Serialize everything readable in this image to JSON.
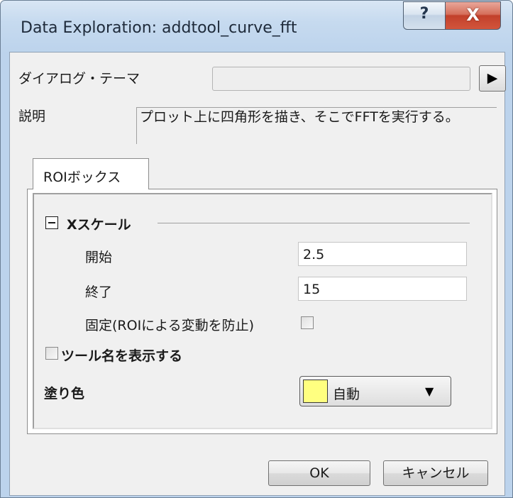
{
  "window": {
    "title": "Data Exploration: addtool_curve_fft",
    "help_glyph": "?",
    "close_glyph": "X"
  },
  "theme": {
    "label": "ダイアログ・テーマ",
    "value": "",
    "arrow_glyph": "▶"
  },
  "description": {
    "label": "説明",
    "text": "プロット上に四角形を描き、そこでFFTを実行する。"
  },
  "tab": {
    "label": "ROIボックス"
  },
  "xscale": {
    "header": "Xスケール",
    "start_label": "開始",
    "start_value": "2.5",
    "end_label": "終了",
    "end_value": "15",
    "fix_label": "固定(ROIによる変動を防止)",
    "fix_checked": false
  },
  "show_tool_name": {
    "label": "ツール名を表示する",
    "checked": false
  },
  "fill_color": {
    "label": "塗り色",
    "value": "自動",
    "swatch_color": "#ffff80",
    "caret": "▼"
  },
  "buttons": {
    "ok": "OK",
    "cancel": "キャンセル"
  }
}
